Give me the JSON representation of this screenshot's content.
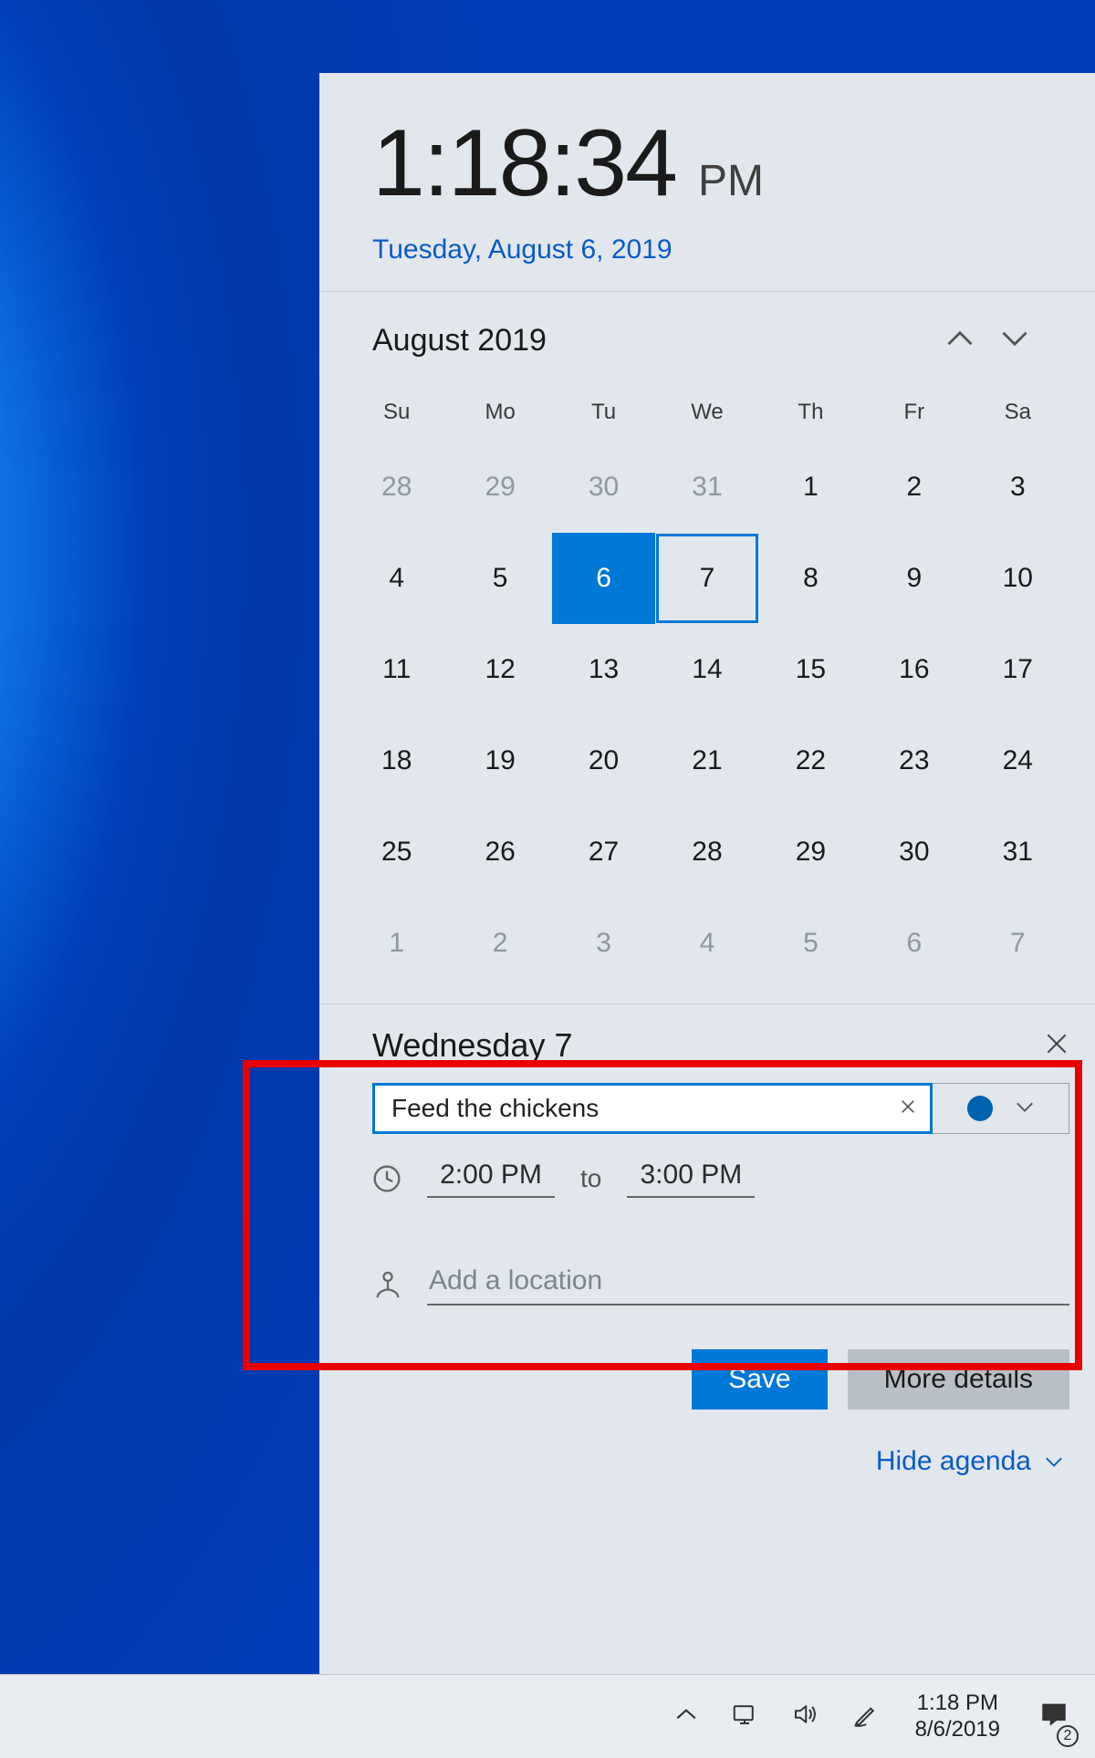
{
  "clock": {
    "time": "1:18:34",
    "ampm": "PM",
    "date_long": "Tuesday, August 6, 2019"
  },
  "calendar": {
    "month_label": "August 2019",
    "dow": [
      "Su",
      "Mo",
      "Tu",
      "We",
      "Th",
      "Fr",
      "Sa"
    ],
    "days": [
      {
        "n": "28",
        "outside": true
      },
      {
        "n": "29",
        "outside": true
      },
      {
        "n": "30",
        "outside": true
      },
      {
        "n": "31",
        "outside": true
      },
      {
        "n": "1"
      },
      {
        "n": "2"
      },
      {
        "n": "3"
      },
      {
        "n": "4"
      },
      {
        "n": "5"
      },
      {
        "n": "6",
        "today": true
      },
      {
        "n": "7",
        "selected": true
      },
      {
        "n": "8"
      },
      {
        "n": "9"
      },
      {
        "n": "10"
      },
      {
        "n": "11"
      },
      {
        "n": "12"
      },
      {
        "n": "13"
      },
      {
        "n": "14"
      },
      {
        "n": "15"
      },
      {
        "n": "16"
      },
      {
        "n": "17"
      },
      {
        "n": "18"
      },
      {
        "n": "19"
      },
      {
        "n": "20"
      },
      {
        "n": "21"
      },
      {
        "n": "22"
      },
      {
        "n": "23"
      },
      {
        "n": "24"
      },
      {
        "n": "25"
      },
      {
        "n": "26"
      },
      {
        "n": "27"
      },
      {
        "n": "28"
      },
      {
        "n": "29"
      },
      {
        "n": "30"
      },
      {
        "n": "31"
      },
      {
        "n": "1",
        "outside": true
      },
      {
        "n": "2",
        "outside": true
      },
      {
        "n": "3",
        "outside": true
      },
      {
        "n": "4",
        "outside": true
      },
      {
        "n": "5",
        "outside": true
      },
      {
        "n": "6",
        "outside": true
      },
      {
        "n": "7",
        "outside": true
      }
    ]
  },
  "agenda": {
    "title_line": "Wednesday 7",
    "event_title": "Feed the chickens",
    "start_time": "2:00 PM",
    "to_label": "to",
    "end_time": "3:00 PM",
    "location_placeholder": "Add a location",
    "calendar_color": "#0063b1"
  },
  "buttons": {
    "save": "Save",
    "more_details": "More details",
    "hide_agenda": "Hide agenda"
  },
  "taskbar": {
    "time": "1:18 PM",
    "date": "8/6/2019",
    "notif_count": "2"
  }
}
